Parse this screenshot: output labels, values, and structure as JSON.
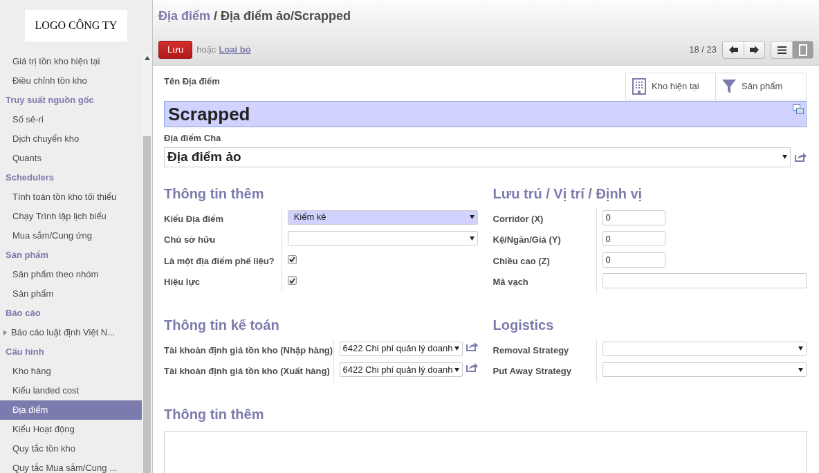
{
  "sidebar": {
    "logo": "LOGO CÔNG TY",
    "items": [
      {
        "kind": "item",
        "label": "Giá trị tồn kho hiện tại",
        "selected": false
      },
      {
        "kind": "item",
        "label": "Điều chỉnh tồn kho",
        "selected": false
      },
      {
        "kind": "header",
        "label": "Truy suất nguồn gốc",
        "selected": false
      },
      {
        "kind": "item",
        "label": "Số sê-ri",
        "selected": false
      },
      {
        "kind": "item",
        "label": "Dịch chuyển kho",
        "selected": false
      },
      {
        "kind": "item",
        "label": "Quants",
        "selected": false
      },
      {
        "kind": "header",
        "label": "Schedulers",
        "selected": false
      },
      {
        "kind": "item",
        "label": "Tính toán tồn kho tối thiểu",
        "selected": false
      },
      {
        "kind": "item",
        "label": "Chạy Trình lập lịch biểu",
        "selected": false
      },
      {
        "kind": "item",
        "label": "Mua sắm/Cung ứng",
        "selected": false
      },
      {
        "kind": "header",
        "label": "Sản phẩm",
        "selected": false
      },
      {
        "kind": "item",
        "label": "Sản phẩm theo nhóm",
        "selected": false
      },
      {
        "kind": "item",
        "label": "Sản phẩm",
        "selected": false
      },
      {
        "kind": "header",
        "label": "Báo cáo",
        "selected": false
      },
      {
        "kind": "folder",
        "label": "Báo cáo luật định Việt N...",
        "selected": false
      },
      {
        "kind": "header",
        "label": "Cấu hình",
        "selected": false
      },
      {
        "kind": "item",
        "label": "Kho hàng",
        "selected": false
      },
      {
        "kind": "item",
        "label": "Kiểu landed cost",
        "selected": false
      },
      {
        "kind": "item",
        "label": "Địa điểm",
        "selected": true
      },
      {
        "kind": "item",
        "label": "Kiểu Hoạt động",
        "selected": false
      },
      {
        "kind": "item",
        "label": "Quy tắc tồn kho",
        "selected": false
      },
      {
        "kind": "item",
        "label": "Quy tắc Mua sắm/Cung ...",
        "selected": false
      }
    ]
  },
  "breadcrumb": {
    "parent": "Địa điểm",
    "separator": "/",
    "current": "Địa điểm ảo/Scrapped"
  },
  "toolbar": {
    "save": "Lưu",
    "or_text": "hoặc",
    "discard": "Loại bỏ",
    "pager": "18 / 23",
    "views": [
      {
        "kind": "list",
        "selected": false
      },
      {
        "kind": "form",
        "selected": true
      }
    ]
  },
  "form": {
    "name_label": "Tên Địa điểm",
    "name_value": "Scrapped",
    "smart_buttons": [
      {
        "kind": "building",
        "label": "Kho hiện tại"
      },
      {
        "kind": "filter",
        "label": "Sản phẩm"
      }
    ],
    "parent_label": "Địa điểm Cha",
    "parent_value": "Địa điểm ảo",
    "left_groups": [
      {
        "title": "Thông tin thêm",
        "fields": [
          {
            "kind": "select",
            "label": "Kiểu Địa điểm",
            "value": "Kiểm kê",
            "required": true
          },
          {
            "kind": "select",
            "label": "Chủ sở hữu",
            "required": false
          },
          {
            "kind": "checkbox",
            "label": "Là một địa điểm phế liệu?",
            "checked": true
          },
          {
            "kind": "checkbox",
            "label": "Hiệu lực",
            "checked": true
          }
        ]
      },
      {
        "title": "Thông tin kế toán",
        "fields": [
          {
            "kind": "many2one",
            "label": "Tài khoản định giá tồn kho (Nhập hàng)",
            "value": "6422 Chi phí quản lý doanh"
          },
          {
            "kind": "many2one",
            "label": "Tài khoản định giá tồn kho (Xuất hàng)",
            "value": "6422 Chi phí quản lý doanh"
          }
        ]
      }
    ],
    "right_groups": [
      {
        "title": "Lưu trú / Vị trí / Định vị",
        "fields": [
          {
            "kind": "number",
            "label": "Corridor (X)",
            "value": "0"
          },
          {
            "kind": "number",
            "label": "Kệ/Ngăn/Giá (Y)",
            "value": "0"
          },
          {
            "kind": "number",
            "label": "Chiều cao (Z)",
            "value": "0"
          },
          {
            "kind": "text",
            "label": "Mã vạch"
          }
        ]
      },
      {
        "title": "Logistics",
        "fields": [
          {
            "kind": "select",
            "label": "Removal Strategy",
            "required": false
          },
          {
            "kind": "select",
            "label": "Put Away Strategy",
            "required": false
          }
        ]
      }
    ],
    "notes_title": "Thông tin thêm"
  }
}
